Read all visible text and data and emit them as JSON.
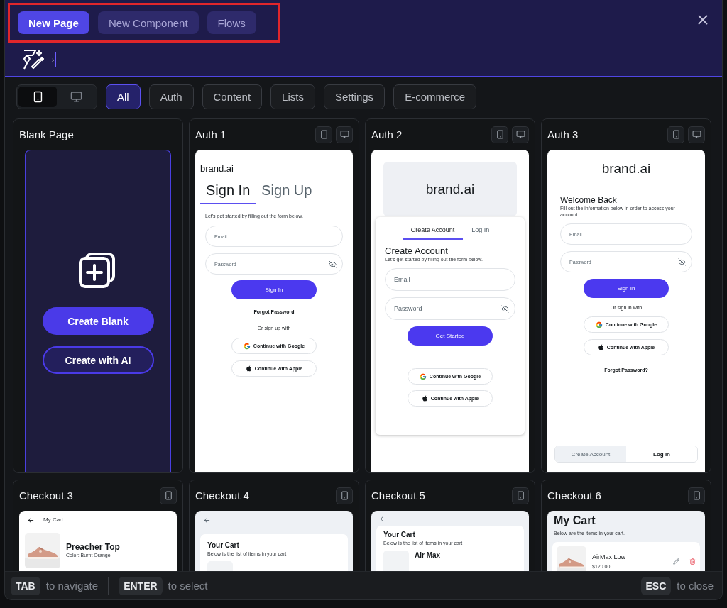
{
  "header": {
    "highlighted": true,
    "tabs": [
      {
        "label": "New Page",
        "selected": true
      },
      {
        "label": "New Component",
        "selected": false
      },
      {
        "label": "Flows",
        "selected": false
      }
    ],
    "prompt": {
      "prefix": "›"
    }
  },
  "device_toggle": [
    {
      "kind": "mobile",
      "selected": true
    },
    {
      "kind": "desktop",
      "selected": false
    }
  ],
  "filters": [
    {
      "label": "All",
      "selected": true
    },
    {
      "label": "Auth",
      "selected": false
    },
    {
      "label": "Content",
      "selected": false
    },
    {
      "label": "Lists",
      "selected": false
    },
    {
      "label": "Settings",
      "selected": false
    },
    {
      "label": "E-commerce",
      "selected": false
    }
  ],
  "templates": [
    {
      "kind": "blank",
      "title": "Blank Page",
      "buttons": [
        "Create Blank",
        "Create with AI"
      ]
    },
    {
      "kind": "auth1",
      "title": "Auth 1",
      "devices": [
        {
          "kind": "mobile"
        },
        {
          "kind": "desktop"
        }
      ],
      "preview": {
        "brand": "brand.ai",
        "tabs": [
          {
            "label": "Sign In",
            "selected": true
          },
          {
            "label": "Sign Up",
            "selected": false
          }
        ],
        "subtitle": "Let's get started by filling out the form below.",
        "fields": [
          {
            "placeholder": "Email",
            "secret": false
          },
          {
            "placeholder": "Password",
            "secret": true
          }
        ],
        "primary": "Sign In",
        "link": "Forgot Password",
        "divider_text": "Or sign up with",
        "social": [
          {
            "kind": "google",
            "label": "Continue with Google"
          },
          {
            "kind": "apple",
            "label": "Continue with Apple"
          }
        ]
      }
    },
    {
      "kind": "auth2",
      "title": "Auth 2",
      "devices": [
        {
          "kind": "mobile"
        },
        {
          "kind": "desktop"
        }
      ],
      "preview": {
        "brand": "brand.ai",
        "tabs": [
          {
            "label": "Create Account",
            "selected": true
          },
          {
            "label": "Log In",
            "selected": false
          }
        ],
        "heading": "Create Account",
        "subtitle": "Let's get started by filling out the form below.",
        "fields": [
          {
            "placeholder": "Email",
            "secret": false
          },
          {
            "placeholder": "Password",
            "secret": true
          }
        ],
        "primary": "Get Started",
        "social": [
          {
            "kind": "google",
            "label": "Continue with Google"
          },
          {
            "kind": "apple",
            "label": "Continue with Apple"
          }
        ]
      }
    },
    {
      "kind": "auth3",
      "title": "Auth 3",
      "devices": [
        {
          "kind": "mobile"
        },
        {
          "kind": "desktop"
        }
      ],
      "preview": {
        "brand": "brand.ai",
        "heading": "Welcome Back",
        "subtitle": "Fill out the information below in order to access your account.",
        "fields": [
          {
            "placeholder": "Email",
            "secret": false
          },
          {
            "placeholder": "Password",
            "secret": true
          }
        ],
        "primary": "Sign In",
        "divider_text": "Or sign in with",
        "social": [
          {
            "kind": "google",
            "label": "Continue with Google"
          },
          {
            "kind": "apple",
            "label": "Continue with Apple"
          }
        ],
        "link": "Forgot Password?",
        "segments": [
          {
            "label": "Create Account",
            "selected": false
          },
          {
            "label": "Log In",
            "selected": true
          }
        ]
      }
    },
    {
      "kind": "cart_list",
      "title": "Checkout 3",
      "devices": [
        {
          "kind": "mobile"
        }
      ],
      "preview": {
        "bar_title": "My Cart",
        "item_name": "Preacher Top",
        "item_detail": "Color: Burnt Orange"
      }
    },
    {
      "kind": "cart_card",
      "title": "Checkout 4",
      "devices": [
        {
          "kind": "mobile"
        }
      ],
      "preview": {
        "heading": "Your Cart",
        "subtitle": "Below is the list of items in your cart"
      }
    },
    {
      "kind": "cart_card",
      "title": "Checkout 5",
      "devices": [
        {
          "kind": "mobile"
        }
      ],
      "preview": {
        "heading": "Your Cart",
        "subtitle": "Below is the list of items in your cart",
        "item_name": "Air Max"
      }
    },
    {
      "kind": "cart_page",
      "title": "Checkout 6",
      "devices": [
        {
          "kind": "mobile"
        }
      ],
      "preview": {
        "heading": "My Cart",
        "subtitle": "Below are the items in your cart.",
        "item_name": "AirMax Low",
        "item_price": "$120.00"
      }
    }
  ],
  "footer": {
    "hints": [
      {
        "key": "TAB",
        "text": "to navigate"
      },
      {
        "key": "ENTER",
        "text": "to select"
      }
    ],
    "close_hint": {
      "key": "ESC",
      "text": "to close"
    }
  }
}
